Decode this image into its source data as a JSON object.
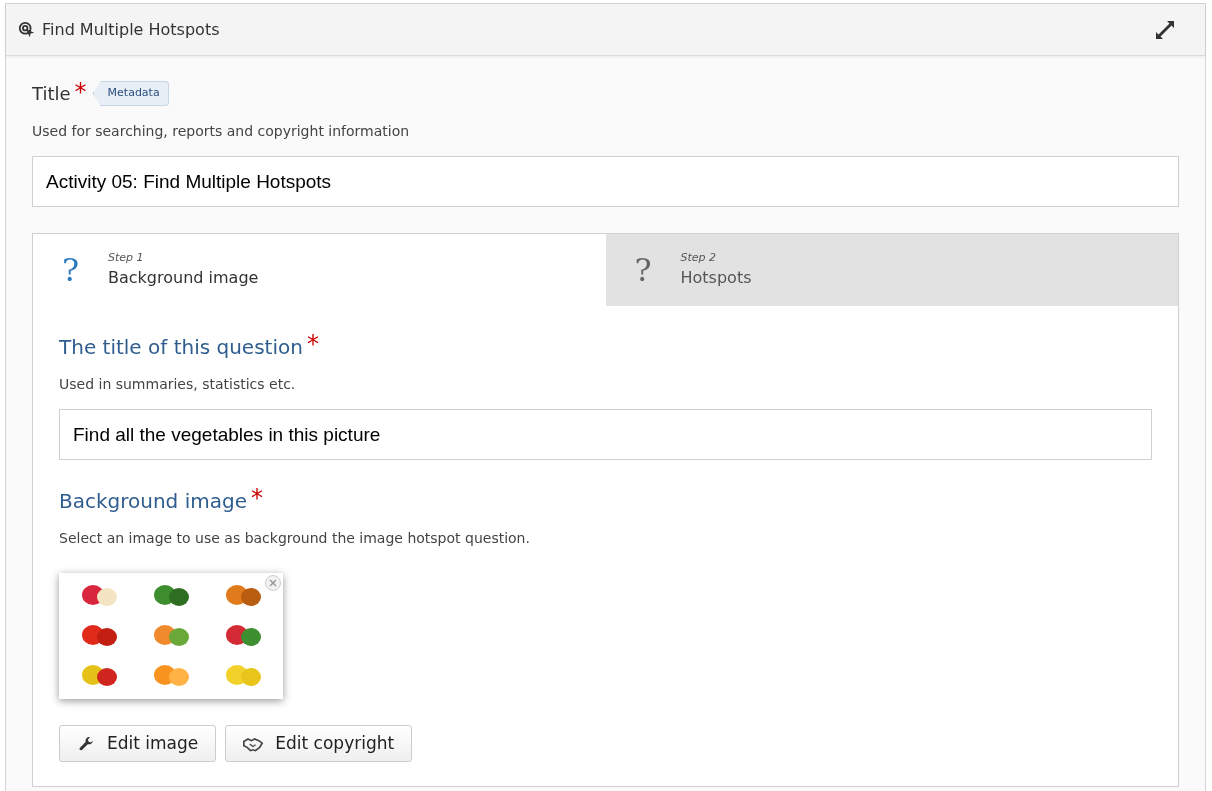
{
  "header": {
    "title": "Find Multiple Hotspots"
  },
  "title_field": {
    "label": "Title",
    "required_mark": "*",
    "badge": "Metadata",
    "description": "Used for searching, reports and copyright information",
    "value": "Activity 05: Find Multiple Hotspots"
  },
  "steps": [
    {
      "icon": "?",
      "step": "Step 1",
      "label": "Background image",
      "selected": true
    },
    {
      "icon": "?",
      "step": "Step 2",
      "label": "Hotspots",
      "selected": false
    }
  ],
  "question_field": {
    "label": "The title of this question",
    "required_mark": "*",
    "description": "Used in summaries, statistics etc.",
    "value": "Find all the vegetables in this picture"
  },
  "image_field": {
    "label": "Background image",
    "required_mark": "*",
    "description": "Select an image to use as background the image hotspot question.",
    "buttons": [
      {
        "kind": "wrench",
        "label": "Edit image"
      },
      {
        "kind": "handshake",
        "label": "Edit copyright"
      }
    ]
  }
}
